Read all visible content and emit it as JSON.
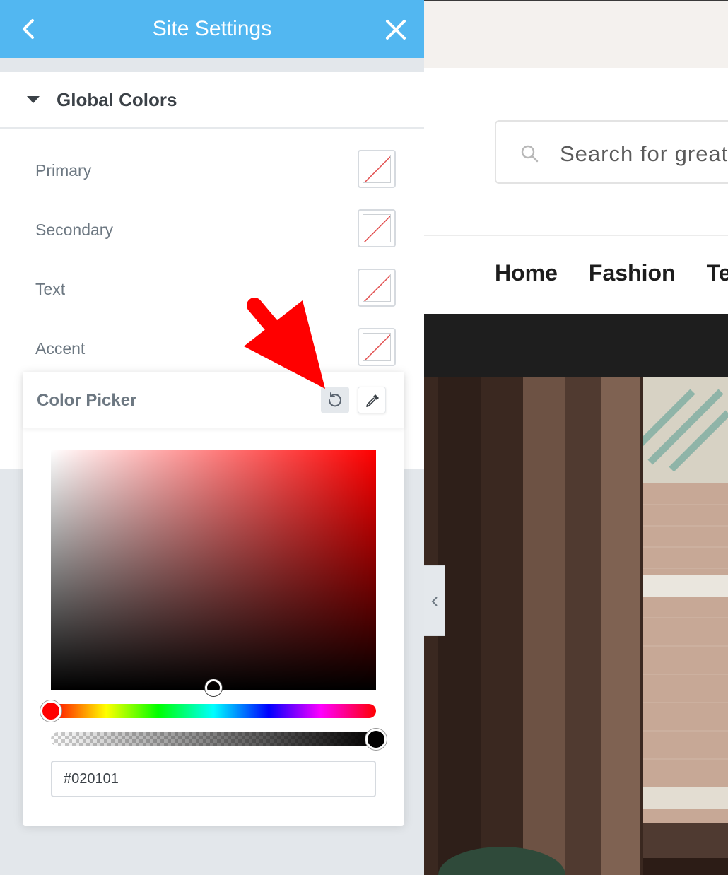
{
  "panel": {
    "title": "Site Settings",
    "section_title": "Global Colors",
    "colors": [
      {
        "label": "Primary"
      },
      {
        "label": "Secondary"
      },
      {
        "label": "Text"
      },
      {
        "label": "Accent"
      }
    ]
  },
  "color_picker": {
    "title": "Color Picker",
    "hex_value": "#020101",
    "hue_position": 0,
    "alpha": 1,
    "saturation": 0.5,
    "brightness": 0.01,
    "hue_color": "#ff0000"
  },
  "preview": {
    "search_placeholder": "Search for great",
    "nav": [
      "Home",
      "Fashion",
      "Tec"
    ]
  },
  "colors": {
    "header_bg": "#52b7f1",
    "annotation_arrow": "#ff0000"
  },
  "icons": {
    "back": "chevron-left-icon",
    "close": "close-icon",
    "reset": "reset-icon",
    "eyedropper": "eyedropper-icon",
    "search": "search-icon",
    "collapse": "chevron-left-icon"
  }
}
